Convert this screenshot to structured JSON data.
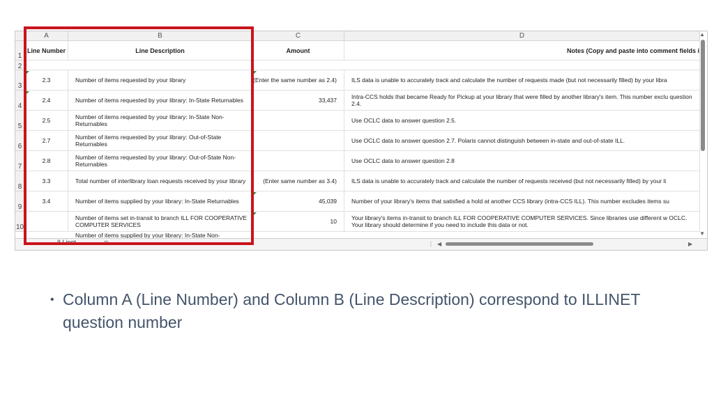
{
  "columns": {
    "a": "A",
    "b": "B",
    "c": "C",
    "d": "D"
  },
  "header": {
    "a": "Line Number",
    "b": "Line Description",
    "c": "Amount",
    "d": "Notes (Copy and paste into comment fields i"
  },
  "row_numbers": [
    "1",
    "2",
    "3",
    "4",
    "5",
    "6",
    "7",
    "8",
    "9",
    "10"
  ],
  "rows": [
    {
      "line": "2.3",
      "desc": "Number of items requested by your library",
      "amount": "(Enter the same number as 2.4)",
      "note": "ILS data is unable to accurately track and calculate the number of requests made (but not necessarily filled) by your libra"
    },
    {
      "line": "2.4",
      "desc": "Number of items requested by your library: In-State Returnables",
      "amount": "33,437",
      "note": "Intra-CCS holds that became Ready for Pickup at your library that were filled by another library's item. This number exclu question 2.4."
    },
    {
      "line": "2.5",
      "desc": "Number of items requested by your library: In-State Non-Returnables",
      "amount": "",
      "note": "Use OCLC data to answer question 2.5."
    },
    {
      "line": "2.7",
      "desc": "Number of items requested by your library: Out-of-State Returnables",
      "amount": "",
      "note": "Use OCLC data to answer question 2.7. Polaris cannot distinguish between in-state and out-of-state ILL."
    },
    {
      "line": "2.8",
      "desc": "Number of items requested by your library: Out-of-State Non-Returnables",
      "amount": "",
      "note": "Use OCLC data to answer question 2.8"
    },
    {
      "line": "3.3",
      "desc": "Total number of interlibrary loan requests received by your library",
      "amount": "(Enter same number as 3.4)",
      "note": "ILS data is unable to accurately track and calculate the number of requests received (but not necessarily filled) by your li"
    },
    {
      "line": "3.4",
      "desc": "Number of items supplied by your library: In-State Returnables",
      "amount": "45,039",
      "note": "Number of your library's items that satisfied a hold at another CCS library (intra-CCS ILL). This number excludes items su"
    },
    {
      "line": "",
      "desc": "Number of items set in-transit to branch ILL FOR COOPERATIVE COMPUTER SERVICES",
      "amount": "10",
      "note": "Your library's items in-transit to branch ILL FOR COOPERATIVE COMPUTER SERVICES. Since libraries use different w OCLC. Your library should determine if you need to include this data or not."
    }
  ],
  "partial_row": "Number of items supplied by your library: In-State Non-",
  "sheet_tab": "ILLinet",
  "bullet": "Column A (Line Number) and Column B (Line Description) correspond to ILLINET question number",
  "colors": {
    "highlight_border": "#c8151d",
    "bullet_text": "#44546a"
  }
}
